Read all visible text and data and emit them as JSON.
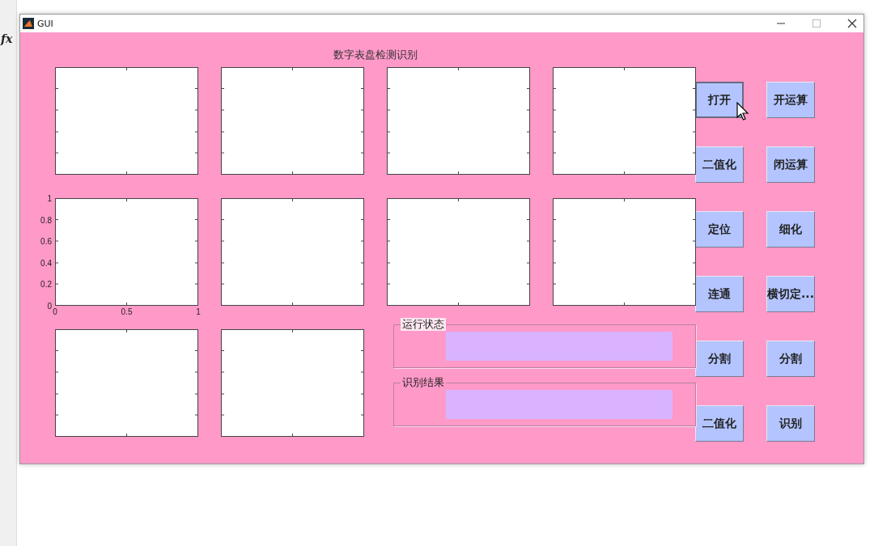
{
  "desktop": {
    "formula_label": "fx"
  },
  "window": {
    "title": "GUI",
    "heading": "数字表盘检测识别"
  },
  "axes": [
    {
      "kind": "blank"
    },
    {
      "kind": "blank"
    },
    {
      "kind": "blank"
    },
    {
      "kind": "blank"
    },
    {
      "kind": "ticked",
      "y_ticks": [
        "1",
        "0.8",
        "0.6",
        "0.4",
        "0.2",
        "0"
      ],
      "x_ticks": [
        "0",
        "0.5",
        "1"
      ]
    },
    {
      "kind": "blank"
    },
    {
      "kind": "blank"
    },
    {
      "kind": "blank"
    },
    {
      "kind": "blank"
    },
    {
      "kind": "blank"
    }
  ],
  "panels": [
    {
      "title": "运行状态",
      "highlighted": true
    },
    {
      "title": "识别结果",
      "highlighted": false
    }
  ],
  "buttons": [
    {
      "label": "打开",
      "focused": true
    },
    {
      "label": "开运算",
      "focused": false
    },
    {
      "label": "二值化",
      "focused": false
    },
    {
      "label": "闭运算",
      "focused": false
    },
    {
      "label": "定位",
      "focused": false
    },
    {
      "label": "细化",
      "focused": false
    },
    {
      "label": "连通",
      "focused": false
    },
    {
      "label": "横切定...",
      "focused": false
    },
    {
      "label": "分割",
      "focused": false
    },
    {
      "label": "分割",
      "focused": false
    },
    {
      "label": "二值化",
      "focused": false
    },
    {
      "label": "识别",
      "focused": false
    }
  ]
}
